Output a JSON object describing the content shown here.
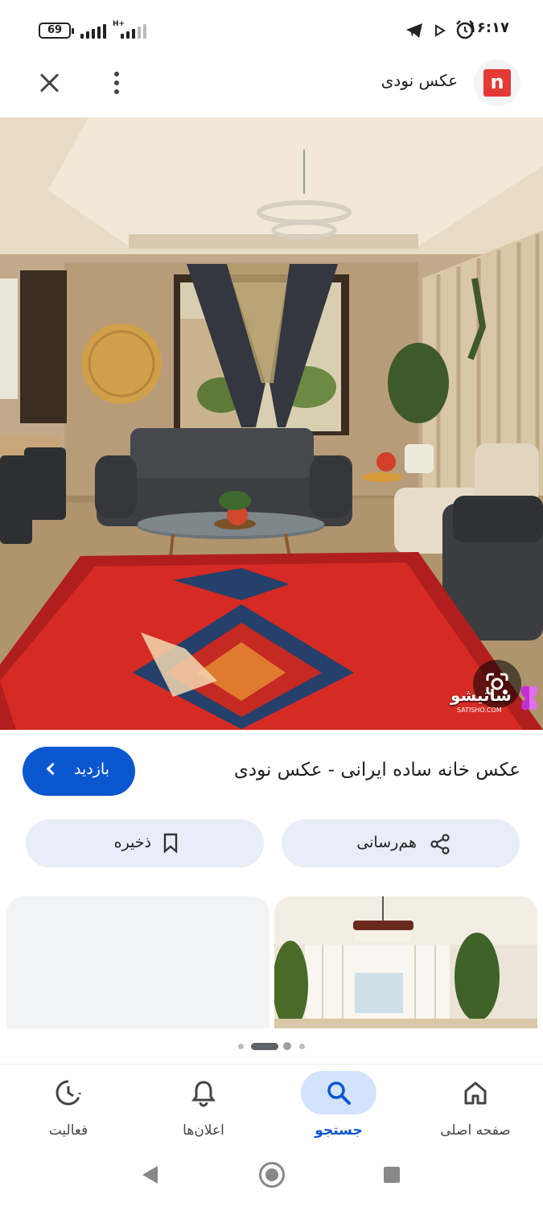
{
  "status_bar": {
    "battery": "69",
    "network": "H+",
    "time": "۱۶:۱۷"
  },
  "header": {
    "site_title": "عکس نودی",
    "site_logo_letter": "n"
  },
  "hero": {
    "watermark": "ساتیشو",
    "watermark_sub": "SATISHO.COM"
  },
  "result": {
    "caption": "عکس خانه ساده ایرانی - عکس نودی",
    "visit_label": "بازدید"
  },
  "actions": {
    "share_label": "هم‌رسانی",
    "save_label": "ذخیره"
  },
  "pager": {
    "pages": 4,
    "active_index": 1
  },
  "bottom_nav": [
    {
      "label": "فعالیت",
      "icon": "activity-icon",
      "active": false
    },
    {
      "label": "اعلان‌ها",
      "icon": "bell-icon",
      "active": false
    },
    {
      "label": "جستجو",
      "icon": "search-icon",
      "active": true
    },
    {
      "label": "صفحه اصلی",
      "icon": "home-icon",
      "active": false
    }
  ],
  "colors": {
    "accent": "#0b57d0",
    "pill_bg": "#e8eef8",
    "active_tab_bg": "#d3e3fd",
    "logo_red": "#e53935"
  }
}
